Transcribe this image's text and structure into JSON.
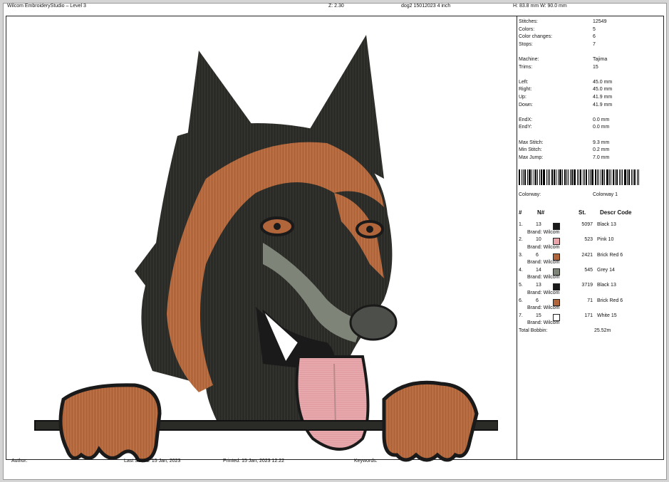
{
  "header": {
    "app_title": "Wilcom EmbroideryStudio – Level 3",
    "zoom": "Z: 2.30",
    "file_name": "dog2 15012023 4 inch",
    "dimensions": "H: 83.8 mm   W: 90.0 mm"
  },
  "stats": [
    {
      "label": "Stitches:",
      "value": "12549"
    },
    {
      "label": "Colors:",
      "value": "5"
    },
    {
      "label": "Color changes:",
      "value": "6"
    },
    {
      "label": "Stops:",
      "value": "7"
    },
    {
      "label": "Machine:",
      "value": "Tajima"
    },
    {
      "label": "Trims:",
      "value": "15"
    },
    {
      "label": "Left:",
      "value": "45.0 mm"
    },
    {
      "label": "Right:",
      "value": "45.0 mm"
    },
    {
      "label": "Up:",
      "value": "41.9 mm"
    },
    {
      "label": "Down:",
      "value": "41.9 mm"
    },
    {
      "label": "EndX:",
      "value": "0.0 mm"
    },
    {
      "label": "EndY:",
      "value": "0.0 mm"
    },
    {
      "label": "Max Stitch:",
      "value": "9.3 mm"
    },
    {
      "label": "Min Stitch:",
      "value": "0.2 mm"
    },
    {
      "label": "Max Jump:",
      "value": "7.0 mm"
    }
  ],
  "colorway": {
    "label": "Colorway:",
    "value": "Colorway 1"
  },
  "threads_header": {
    "num": "#",
    "n": "N#",
    "st": "St.",
    "descr": "Descr  Code"
  },
  "threads": [
    {
      "idx": "1.",
      "n": "13",
      "color": "#1a1a1a",
      "st": "5097",
      "descr": "Black 13",
      "brand": "Brand: Wilcom"
    },
    {
      "idx": "2.",
      "n": "10",
      "color": "#e8a4a8",
      "st": "523",
      "descr": "Pink 10",
      "brand": "Brand: Wilcom"
    },
    {
      "idx": "3.",
      "n": "6",
      "color": "#b0653a",
      "st": "2421",
      "descr": "Brick Red 6",
      "brand": "Brand: Wilcom"
    },
    {
      "idx": "4.",
      "n": "14",
      "color": "#7e8478",
      "st": "545",
      "descr": "Grey 14",
      "brand": "Brand: Wilcom"
    },
    {
      "idx": "5.",
      "n": "13",
      "color": "#1a1a1a",
      "st": "3719",
      "descr": "Black 13",
      "brand": "Brand: Wilcom"
    },
    {
      "idx": "6.",
      "n": "6",
      "color": "#b0653a",
      "st": "71",
      "descr": "Brick Red 6",
      "brand": "Brand: Wilcom"
    },
    {
      "idx": "7.",
      "n": "15",
      "color": "#ffffff",
      "st": "171",
      "descr": "White 15",
      "brand": "Brand: Wilcom"
    }
  ],
  "total_bobbin": {
    "label": "Total Bobbin:",
    "value": "25.52m"
  },
  "footer": {
    "author": "Author:",
    "last_saved": "Last Saved: 15 Jan, 2023",
    "printed": "Printed: 15 Jan, 2023 12:22",
    "keywords": "Keywords:"
  }
}
